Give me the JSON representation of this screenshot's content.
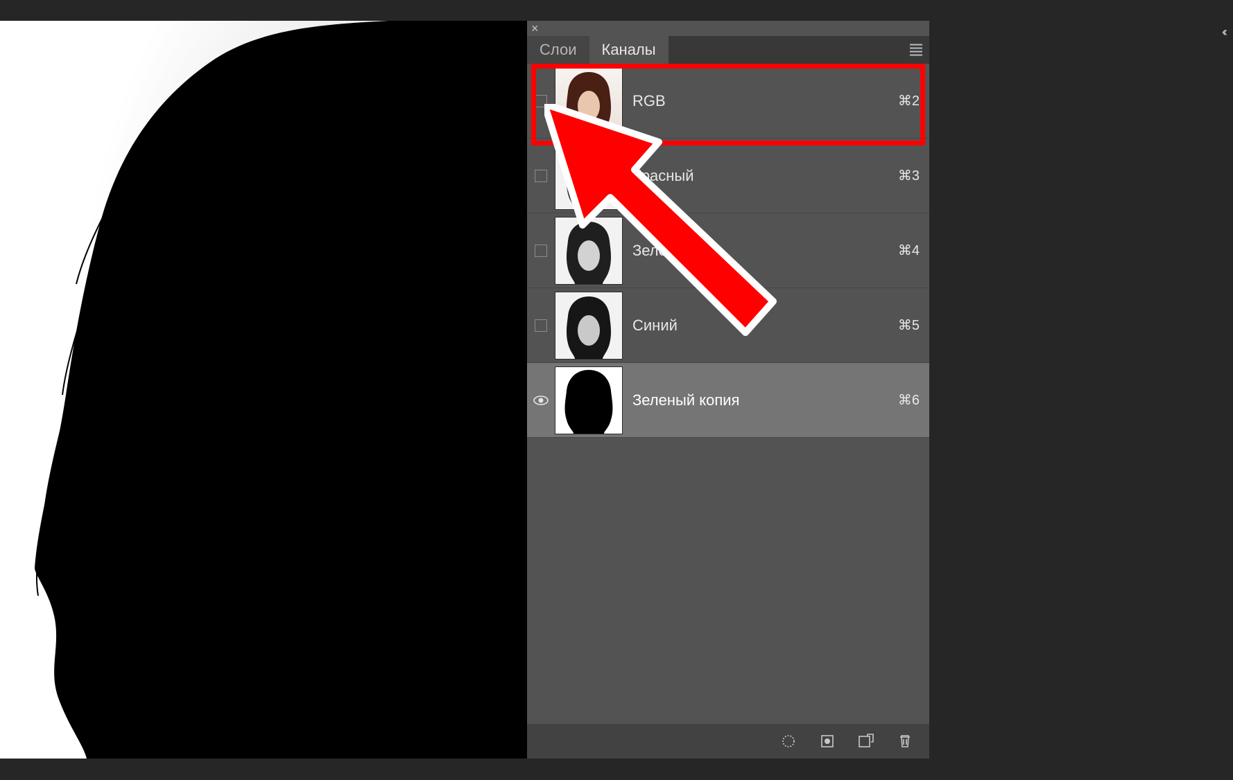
{
  "panel": {
    "tabs": [
      {
        "label": "Слои",
        "active": false
      },
      {
        "label": "Каналы",
        "active": true
      }
    ],
    "channels": [
      {
        "name": "RGB",
        "shortcut": "⌘2",
        "visible": false,
        "selected": false,
        "thumb": "color"
      },
      {
        "name": "Красный",
        "shortcut": "⌘3",
        "visible": false,
        "selected": false,
        "thumb": "bw"
      },
      {
        "name": "Зеленый",
        "shortcut": "⌘4",
        "visible": false,
        "selected": false,
        "thumb": "bw"
      },
      {
        "name": "Синий",
        "shortcut": "⌘5",
        "visible": false,
        "selected": false,
        "thumb": "bw"
      },
      {
        "name": "Зеленый копия",
        "shortcut": "⌘6",
        "visible": true,
        "selected": true,
        "thumb": "alpha"
      }
    ],
    "footer_icons": [
      "load-selection",
      "save-selection",
      "new-channel",
      "delete-channel"
    ]
  }
}
